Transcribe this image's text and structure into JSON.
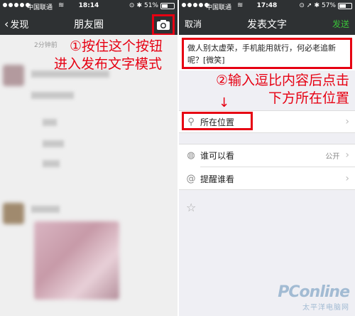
{
  "left": {
    "status": {
      "carrier": "中国联通",
      "time": "18:14",
      "battery": "51%",
      "battery_level": 0.51
    },
    "nav": {
      "back_label": "发现",
      "title": "朋友圈"
    },
    "feed": {
      "timestamp": "2分钟前"
    },
    "annotation": {
      "line1": "①按住这个按钮",
      "line2": "进入发布文字模式"
    }
  },
  "right": {
    "status": {
      "carrier": "中国联通",
      "time": "17:48",
      "battery": "57%",
      "battery_level": 0.57
    },
    "nav": {
      "cancel_label": "取消",
      "title": "发表文字",
      "send_label": "发送"
    },
    "compose_text": "做人别太虚荣，手机能用就行，何必老追新呢？[微笑]",
    "annotation": {
      "line1": "②输入逗比内容后点击",
      "line2": "下方所在位置",
      "arrow": "↓"
    },
    "rows": {
      "location": {
        "label": "所在位置"
      },
      "visibility": {
        "label": "谁可以看",
        "value": "公开"
      },
      "remind": {
        "label": "提醒谁看"
      }
    }
  },
  "watermark": {
    "logo": "PConline",
    "sub": "太平洋电脑网"
  },
  "colors": {
    "annotation_red": "#e60012",
    "send_green": "#39c239",
    "navbar": "#2e3133"
  }
}
